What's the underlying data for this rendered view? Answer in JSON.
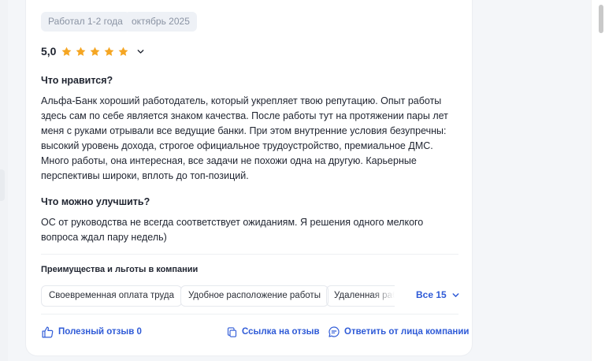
{
  "tags": [
    "Работал 1-2 года",
    "октябрь 2025"
  ],
  "rating": {
    "value": "5,0",
    "stars": 5,
    "max_stars": 5,
    "star_color": "#f5a623",
    "expand_icon": "chevron-down-icon"
  },
  "likes": {
    "title": "Что нравится?",
    "text": "Альфа-Банк хороший работодатель, который укрепляет твою репутацию. Опыт работы здесь сам по себе является знаком качества. После работы тут на протяжении пары лет меня с руками отрывали все ведущие банки. При этом внутренние условия безупречны: высокий уровень дохода, строгое официальное трудоустройство, премиальное ДМС. Много работы, она интересная, все задачи не похожи одна на другую. Карьерные перспективы широки, вплоть до топ-позиций."
  },
  "improve": {
    "title": "Что можно улучшить?",
    "text": "ОС от руководства не всегда соответствует ожиданиям. Я решения одного мелкого вопроса ждал пару недель)"
  },
  "benefits": {
    "title": "Преимущества и льготы в компании",
    "items": [
      "Своевременная оплата труда",
      "Удобное расположение работы",
      "Удаленная раб"
    ],
    "all_label": "Все 15"
  },
  "actions": {
    "useful": "Полезный отзыв 0",
    "link": "Ссылка на отзыв",
    "reply": "Ответить от лица компании"
  },
  "colors": {
    "accent": "#2f5bd7",
    "text": "#1f2430",
    "muted": "#8a93a3"
  }
}
